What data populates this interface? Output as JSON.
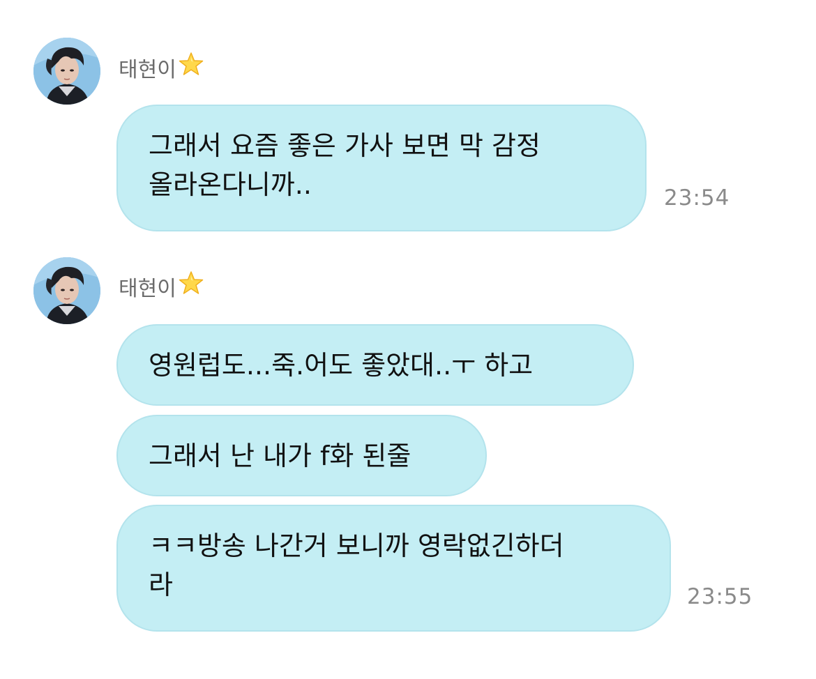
{
  "messages": [
    {
      "sender": "태현이",
      "sender_badge": "star-icon",
      "bubbles": [
        {
          "lines": [
            "그래서 요즘 좋은 가사 보면 막 감정",
            "올라온다니까.."
          ],
          "time": "23:54"
        }
      ]
    },
    {
      "sender": "태현이",
      "sender_badge": "star-icon",
      "bubbles": [
        {
          "lines": [
            "영원럽도...죽.어도 좋았대..ㅜ 하고"
          ]
        },
        {
          "lines": [
            "그래서 난 내가 f화 된줄"
          ]
        },
        {
          "lines": [
            "ㅋㅋ방송 나간거 보니까 영락없긴하더",
            "라"
          ],
          "time": "23:55"
        }
      ]
    }
  ],
  "colors": {
    "bubble_bg": "#c4eef4",
    "bubble_border": "#b3e3ec",
    "sender_text": "#6b6b6b",
    "time_text": "#8a8a8a",
    "message_text": "#111111",
    "avatar_bg": "#7fb6dc"
  }
}
